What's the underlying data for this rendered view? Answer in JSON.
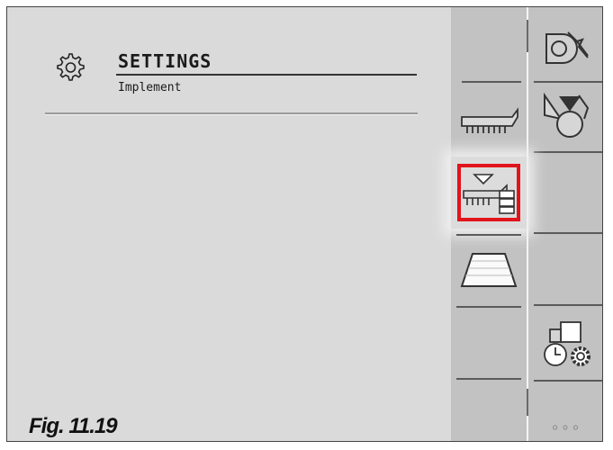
{
  "header": {
    "title": "SETTINGS",
    "subtitle": "Implement",
    "icon": "gear-icon"
  },
  "caption": "Fig. 11.19",
  "sidebar": {
    "buttons": [
      {
        "id": "seed-rate-icon",
        "label": ""
      },
      {
        "id": "seed-drill-icon",
        "label": ""
      },
      {
        "id": "metering-unit-icon",
        "label": ""
      },
      {
        "id": "implement-config-icon",
        "label": "",
        "highlighted": true,
        "highlight_color": "#e0141c"
      },
      {
        "id": "tramline-icon",
        "label": ""
      },
      {
        "id": "timer-settings-icon",
        "label": ""
      },
      {
        "id": "more-button",
        "label": "◦◦◦"
      }
    ]
  },
  "colors": {
    "screen": "#dadada",
    "sidebar": "#c2c2c2",
    "highlight": "#e0141c"
  }
}
